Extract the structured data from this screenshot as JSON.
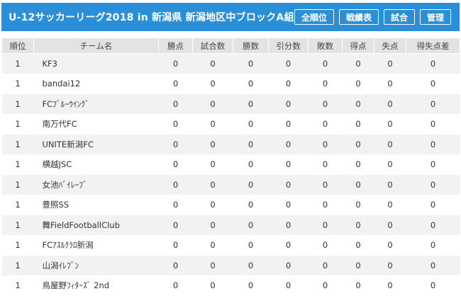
{
  "header": {
    "title": "U-12サッカーリーグ2018 in 新潟県 新潟地区中ブロックA組",
    "buttons": [
      "全順位",
      "戦績表",
      "試合",
      "管理"
    ]
  },
  "table": {
    "columns": [
      "順位",
      "チーム名",
      "勝点",
      "試合数",
      "勝数",
      "引分数",
      "敗数",
      "得点",
      "失点",
      "得失点差"
    ],
    "rows": [
      [
        "1",
        "KF3",
        "0",
        "0",
        "0",
        "0",
        "0",
        "0",
        "0",
        "0"
      ],
      [
        "1",
        "bandai12",
        "0",
        "0",
        "0",
        "0",
        "0",
        "0",
        "0",
        "0"
      ],
      [
        "1",
        "FCﾌﾞﾙｰｳｲﾝｸﾞ",
        "0",
        "0",
        "0",
        "0",
        "0",
        "0",
        "0",
        "0"
      ],
      [
        "1",
        "南万代FC",
        "0",
        "0",
        "0",
        "0",
        "0",
        "0",
        "0",
        "0"
      ],
      [
        "1",
        "UNITE新潟FC",
        "0",
        "0",
        "0",
        "0",
        "0",
        "0",
        "0",
        "0"
      ],
      [
        "1",
        "横越JSC",
        "0",
        "0",
        "0",
        "0",
        "0",
        "0",
        "0",
        "0"
      ],
      [
        "1",
        "女池ﾊﾞｲﾚｰﾌﾞ",
        "0",
        "0",
        "0",
        "0",
        "0",
        "0",
        "0",
        "0"
      ],
      [
        "1",
        "豊照SS",
        "0",
        "0",
        "0",
        "0",
        "0",
        "0",
        "0",
        "0"
      ],
      [
        "1",
        "舞FieldFootballClub",
        "0",
        "0",
        "0",
        "0",
        "0",
        "0",
        "0",
        "0"
      ],
      [
        "1",
        "FCｱｽﾙｸﾗﾛ新潟",
        "0",
        "0",
        "0",
        "0",
        "0",
        "0",
        "0",
        "0"
      ],
      [
        "1",
        "山潟ｲﾚﾌﾞﾝ",
        "0",
        "0",
        "0",
        "0",
        "0",
        "0",
        "0",
        "0"
      ],
      [
        "1",
        "鳥屋野ﾌｨﾀｰｽﾞ 2nd",
        "0",
        "0",
        "0",
        "0",
        "0",
        "0",
        "0",
        "0"
      ]
    ]
  }
}
